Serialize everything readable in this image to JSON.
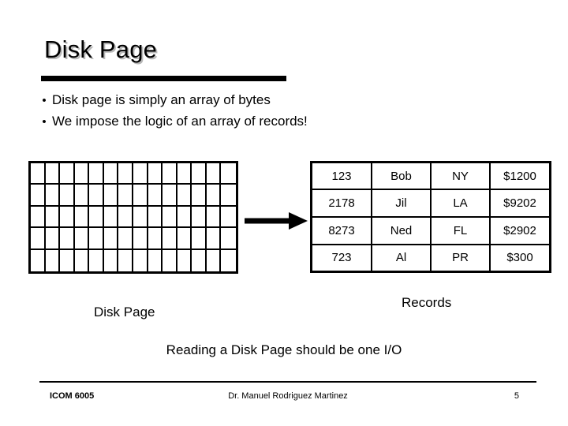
{
  "slide": {
    "title": "Disk Page",
    "bullets": [
      {
        "marker": "•",
        "text": "Disk page is simply an array of bytes"
      },
      {
        "marker": "•",
        "text": "We impose the logic of an array of records!"
      }
    ],
    "disk_page_caption": "Disk Page",
    "records_caption": "Records",
    "io_note": "Reading a Disk Page should be one I/O",
    "arrow_label": "right-arrow"
  },
  "disk_page_grid": {
    "columns": 14,
    "rows": 5
  },
  "records_table": {
    "rows": [
      [
        "123",
        "Bob",
        "NY",
        "$1200"
      ],
      [
        "2178",
        "Jil",
        "LA",
        "$9202"
      ],
      [
        "8273",
        "Ned",
        "FL",
        "$2902"
      ],
      [
        "723",
        "Al",
        "PR",
        "$300"
      ]
    ]
  },
  "footer": {
    "course": "ICOM 6005",
    "author": "Dr. Manuel Rodriguez Martinez",
    "page_number": "5"
  },
  "colors": {
    "ink": "#000000",
    "background": "#ffffff",
    "title_shadow": "#b8b8b8"
  }
}
